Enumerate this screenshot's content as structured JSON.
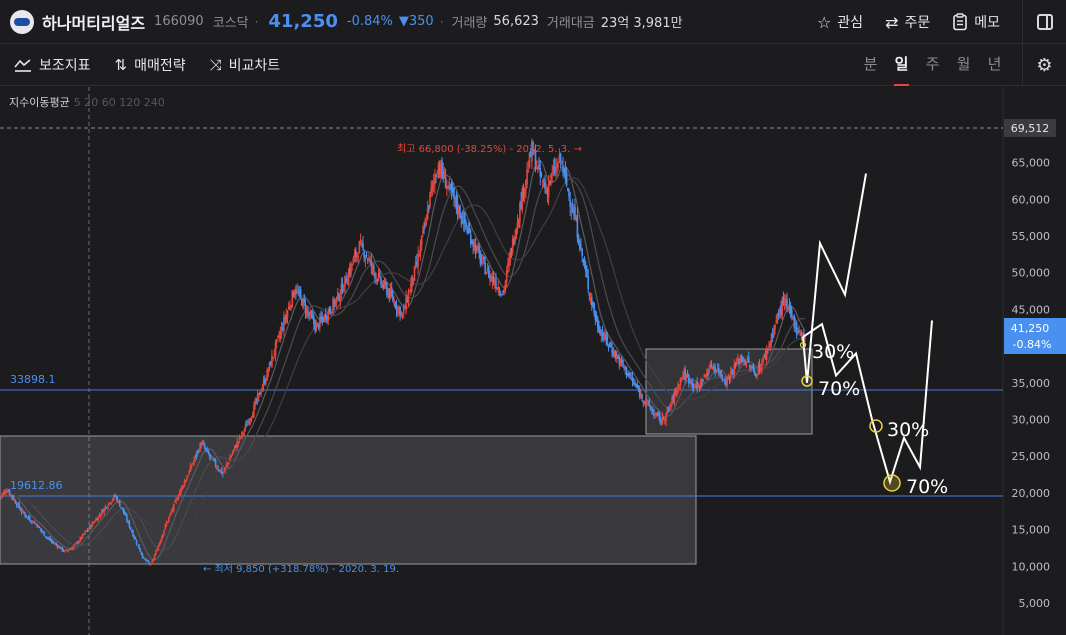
{
  "header": {
    "name": "하나머티리얼즈",
    "code": "166090",
    "market": "코스닥",
    "price": "41,250",
    "change_pct": "-0.84%",
    "change_abs": "▼350",
    "volume_label": "거래량",
    "volume": "56,623",
    "amount_label": "거래대금",
    "amount": "23억 3,981만",
    "interest_label": "관심",
    "order_label": "주문",
    "memo_label": "메모"
  },
  "toolbar": {
    "indicator_label": "보조지표",
    "strategy_label": "매매전략",
    "compare_label": "비교차트",
    "periods": [
      "분",
      "일",
      "주",
      "월",
      "년"
    ]
  },
  "chart": {
    "indicator_title": "지수이동평균",
    "indicator_sub": "5 20 60 120 240",
    "ref_price_label": "69,512",
    "high_annotation": "최고 66,800 (-38.25%) - 2022. 5. 3. →",
    "low_annotation": "← 최저 9,850 (+318.78%) - 2020. 3. 19.",
    "hline_upper_label": "33898.1",
    "hline_lower_label": "19612.86",
    "current_price_tag": "41,250",
    "current_change_tag": "-0.84%",
    "fib_labels": [
      "30%",
      "70%",
      "30%",
      "70%"
    ],
    "colors": {
      "up": "#e2463c",
      "down": "#4a90f0",
      "hline": "#3b7fe0",
      "accent": "#4a90f0"
    }
  },
  "chart_data": {
    "type": "candlestick",
    "y_axis_ticks": [
      "65,000",
      "60,000",
      "55,000",
      "50,000",
      "45,000",
      "35,000",
      "30,000",
      "25,000",
      "20,000",
      "15,000",
      "10,000",
      "5,000"
    ],
    "ylim": [
      2500,
      72000
    ],
    "high": 66800,
    "low": 9850,
    "current": 41250,
    "hlines": [
      33898.1,
      19612.86
    ],
    "scenario_path_upper": [
      41250,
      35000,
      54000,
      47000,
      63500
    ],
    "scenario_path_lower": [
      41250,
      43000,
      36000,
      39000,
      30000,
      21500,
      27500,
      23500,
      43500
    ],
    "series": [
      {
        "values": [
          19500,
          20500,
          19000,
          17500,
          16500,
          15800,
          14500,
          13500,
          12800,
          12000,
          12500,
          13500,
          14800,
          16000,
          17200,
          18500,
          19600,
          17800,
          15500,
          13200,
          11000,
          10200,
          12800,
          15500,
          17800,
          20200,
          22200,
          24500,
          26800,
          25200,
          23800,
          22600,
          24800,
          26800,
          28600,
          30800,
          33200,
          35800,
          38800,
          41800,
          44800,
          47800,
          46200,
          44200,
          42600,
          43800,
          45200,
          46600,
          48800,
          51200,
          53600,
          52400,
          50200,
          48600,
          47400,
          45800,
          44200,
          47800,
          51200,
          55800,
          61200,
          64800,
          62400,
          60200,
          58200,
          55800,
          53800,
          51400,
          49800,
          48600,
          47200,
          52400,
          57400,
          62200,
          66800,
          63400,
          61200,
          63600,
          65400,
          61200,
          57400,
          52200,
          47400,
          43200,
          41200,
          39800,
          38200,
          36800,
          35200,
          33600,
          32200,
          30800,
          29800,
          31200,
          33800,
          36200,
          35400,
          34200,
          35800,
          37400,
          36600,
          35200,
          36800,
          38400,
          37800,
          36200,
          37600,
          40200,
          43400,
          46200,
          44200,
          42200,
          41250
        ]
      }
    ]
  }
}
